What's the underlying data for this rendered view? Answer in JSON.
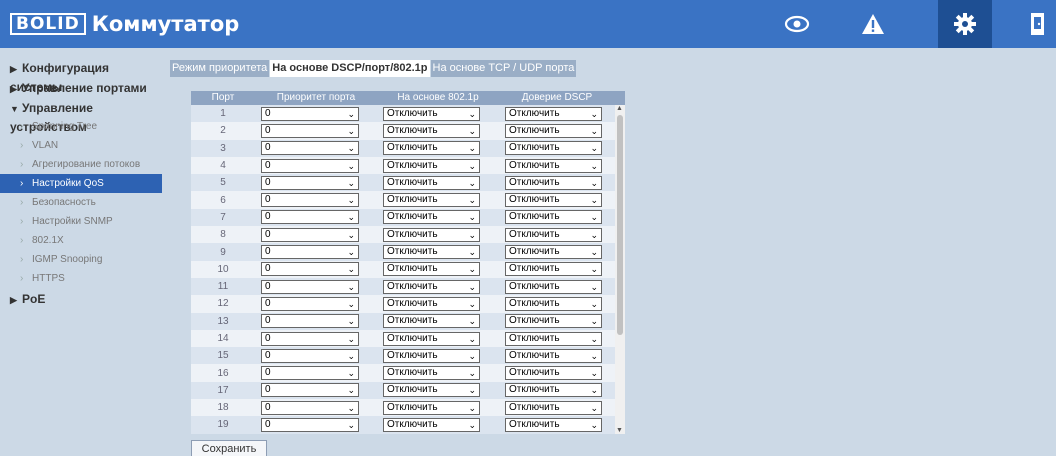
{
  "header": {
    "logo_text": "BOLID",
    "title": "Коммутатор",
    "icons": [
      "eye-icon",
      "warning-icon",
      "gear-icon",
      "logout-icon"
    ]
  },
  "sidebar": {
    "groups": [
      {
        "label": "Конфигурация системы",
        "expanded": false
      },
      {
        "label": "Управление портами",
        "expanded": false
      },
      {
        "label": "Управление устройством",
        "expanded": true
      },
      {
        "label": "PoE",
        "expanded": false
      }
    ],
    "items": [
      {
        "label": "Spanning Tree"
      },
      {
        "label": "VLAN"
      },
      {
        "label": "Агрегирование потоков"
      },
      {
        "label": "Настройки QoS",
        "active": true
      },
      {
        "label": "Безопасность"
      },
      {
        "label": "Настройки SNMP"
      },
      {
        "label": "802.1X"
      },
      {
        "label": "IGMP Snooping"
      },
      {
        "label": "HTTPS"
      }
    ]
  },
  "tabs": [
    {
      "label": "Режим приоритета"
    },
    {
      "label": "На основе DSCP/порт/802.1p",
      "active": true
    },
    {
      "label": "На основе TCP / UDP порта"
    }
  ],
  "table": {
    "headers": [
      "Порт",
      "Приоритет порта",
      "На основе 802.1p",
      "Доверие DSCP"
    ],
    "rows": [
      {
        "port": "1",
        "priority": "0",
        "p8021": "Отключить",
        "dscp": "Отключить"
      },
      {
        "port": "2",
        "priority": "0",
        "p8021": "Отключить",
        "dscp": "Отключить"
      },
      {
        "port": "3",
        "priority": "0",
        "p8021": "Отключить",
        "dscp": "Отключить"
      },
      {
        "port": "4",
        "priority": "0",
        "p8021": "Отключить",
        "dscp": "Отключить"
      },
      {
        "port": "5",
        "priority": "0",
        "p8021": "Отключить",
        "dscp": "Отключить"
      },
      {
        "port": "6",
        "priority": "0",
        "p8021": "Отключить",
        "dscp": "Отключить"
      },
      {
        "port": "7",
        "priority": "0",
        "p8021": "Отключить",
        "dscp": "Отключить"
      },
      {
        "port": "8",
        "priority": "0",
        "p8021": "Отключить",
        "dscp": "Отключить"
      },
      {
        "port": "9",
        "priority": "0",
        "p8021": "Отключить",
        "dscp": "Отключить"
      },
      {
        "port": "10",
        "priority": "0",
        "p8021": "Отключить",
        "dscp": "Отключить"
      },
      {
        "port": "11",
        "priority": "0",
        "p8021": "Отключить",
        "dscp": "Отключить"
      },
      {
        "port": "12",
        "priority": "0",
        "p8021": "Отключить",
        "dscp": "Отключить"
      },
      {
        "port": "13",
        "priority": "0",
        "p8021": "Отключить",
        "dscp": "Отключить"
      },
      {
        "port": "14",
        "priority": "0",
        "p8021": "Отключить",
        "dscp": "Отключить"
      },
      {
        "port": "15",
        "priority": "0",
        "p8021": "Отключить",
        "dscp": "Отключить"
      },
      {
        "port": "16",
        "priority": "0",
        "p8021": "Отключить",
        "dscp": "Отключить"
      },
      {
        "port": "17",
        "priority": "0",
        "p8021": "Отключить",
        "dscp": "Отключить"
      },
      {
        "port": "18",
        "priority": "0",
        "p8021": "Отключить",
        "dscp": "Отключить"
      },
      {
        "port": "19",
        "priority": "0",
        "p8021": "Отключить",
        "dscp": "Отключить"
      }
    ]
  },
  "save_label": "Сохранить",
  "colors": {
    "header": "#3a73c4",
    "active_nav": "#2d62b3",
    "background": "#ccd9e6"
  }
}
